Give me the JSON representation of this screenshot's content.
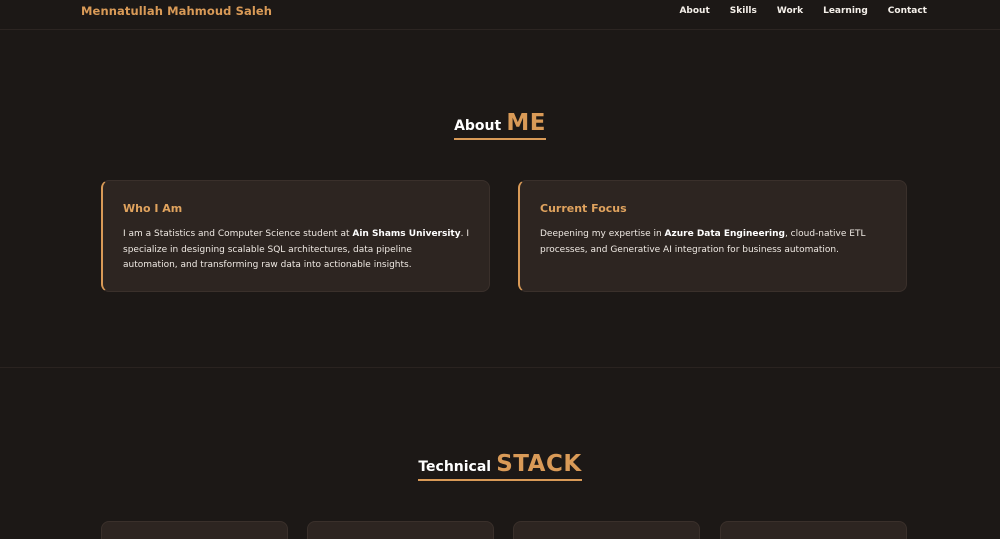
{
  "header": {
    "brand": "Mennatullah Mahmoud Saleh",
    "nav": [
      "About",
      "Skills",
      "Work",
      "Learning",
      "Contact"
    ]
  },
  "about": {
    "title_light": "About",
    "title_accent": "ME",
    "cards": [
      {
        "title": "Who I Am",
        "body_pre": "I am a Statistics and Computer Science student at ",
        "body_bold": "Ain Shams University",
        "body_post": ". I specialize in designing scalable SQL architectures, data pipeline automation, and transforming raw data into actionable insights."
      },
      {
        "title": "Current Focus",
        "body_pre": "Deepening my expertise in ",
        "body_bold": "Azure Data Engineering",
        "body_post": ", cloud-native ETL processes, and Generative AI integration for business automation."
      }
    ]
  },
  "stack": {
    "title_light": "Technical",
    "title_accent": "STACK"
  },
  "colors": {
    "background": "#1c1816",
    "accent": "#d99a57",
    "card": "#2d2521"
  }
}
